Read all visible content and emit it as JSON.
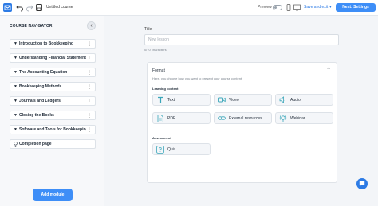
{
  "topbar": {
    "title": "Untitled course",
    "preview_label": "Preview",
    "save_label": "Save and exit",
    "next_label": "Next: Settings"
  },
  "sidebar": {
    "title": "COURSE NAVIGATOR",
    "items": [
      {
        "label": "Introduction to Bookkeeping"
      },
      {
        "label": "Understanding Financial Statements"
      },
      {
        "label": "The Accounting Equation"
      },
      {
        "label": "Bookkeeping Methods"
      },
      {
        "label": "Journals and Ledgers"
      },
      {
        "label": "Closing the Books"
      },
      {
        "label": "Software and Tools for Bookkeeping"
      },
      {
        "label": "Completion page"
      }
    ],
    "add_module_label": "Add module"
  },
  "main": {
    "title_label": "Title",
    "title_placeholder": "New lesson",
    "char_count": "0/70 characters",
    "format": {
      "heading": "Format",
      "subheading": "Here, you choose how you want to present your course content.",
      "learning_label": "Learning content",
      "learning_options": [
        {
          "label": "Text",
          "icon": "text-icon"
        },
        {
          "label": "Video",
          "icon": "video-icon"
        },
        {
          "label": "Audio",
          "icon": "audio-icon"
        },
        {
          "label": "PDF",
          "icon": "pdf-icon"
        },
        {
          "label": "External resources",
          "icon": "link-icon"
        },
        {
          "label": "Webinar",
          "icon": "webinar-icon"
        }
      ],
      "assessment_label": "Assessment",
      "assessment_options": [
        {
          "label": "Quiz",
          "icon": "quiz-icon"
        }
      ]
    }
  },
  "colors": {
    "accent": "#3e8ef7",
    "icon_teal": "#3aa6b9"
  }
}
